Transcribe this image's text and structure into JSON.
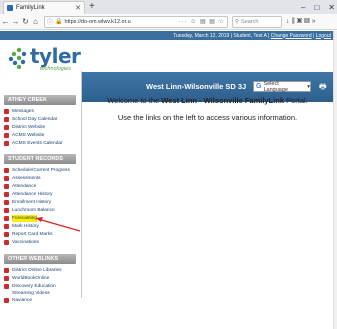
{
  "browser": {
    "tab_title": "FamilyLink",
    "url": "https://do-om.wlwv.k12.or.u",
    "search_placeholder": "Search",
    "url_icons": "··· ☺ ▤ ▤ ☆",
    "right_icons": "↓ ⫼ ▣ ▤ »",
    "window_controls": [
      "–",
      "□",
      "✕"
    ]
  },
  "header": {
    "date_user": "Tuesday, March 12, 2019  |  Student, Test A  |",
    "change_password": "Change Password",
    "logout": "Logout",
    "logo_word": "tyler",
    "logo_sub": "technologies",
    "district": "West Linn-Wilsonville SD 3J",
    "language_button": "Select Language"
  },
  "sidebar": {
    "sections": [
      {
        "title": "ATHEY CREEK",
        "items": [
          "Messages",
          "School Day Calendar",
          "District Website",
          "ACMS Website",
          "ACMS Events Calendar"
        ]
      },
      {
        "title": "STUDENT RECORDS",
        "items": [
          "Schedule/Current Progress",
          "Assessments",
          "Attendance",
          "Attendance History",
          "Enrollment History",
          "Lunchroom Balance",
          "Forecasting",
          "Mark History",
          "Report Card Marks",
          "Vaccinations"
        ]
      },
      {
        "title": "OTHER WEBLINKS",
        "items": [
          "District Online Libraries",
          "WorldBookOnline",
          "Discovery Education Streaming Videos",
          "Naviance"
        ]
      }
    ]
  },
  "main": {
    "welcome_prefix": "Welcome to the ",
    "welcome_bold": "West Linn - Wilsonville FamilyLink",
    "welcome_suffix": " Portal.",
    "instructions": "Use the links on the left to access various information."
  }
}
